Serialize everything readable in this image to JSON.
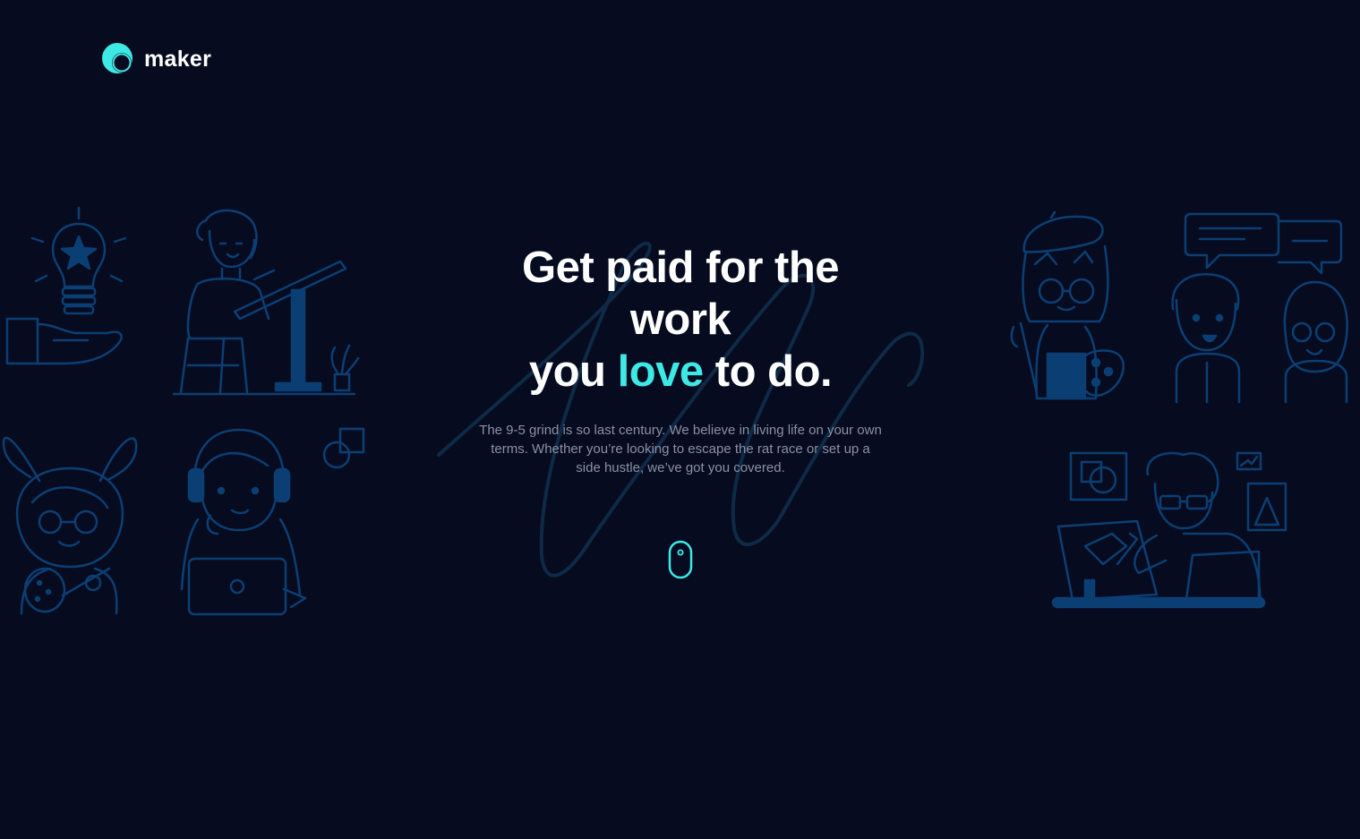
{
  "brand": {
    "name": "maker",
    "accent_color": "#3ee9e5",
    "background_color": "#060b1f"
  },
  "hero": {
    "title_line1": "Get paid for the",
    "title_line2": "work",
    "title_line3_pre": "you",
    "title_highlight": "love",
    "title_line3_post": "to do.",
    "description": "The 9-5 grind is so last century. We believe in living life on your own terms. Whether you’re looking to escape the rat race or set up a side hustle, we’ve got you covered."
  },
  "scroll_indicator": {
    "icon": "mouse-icon"
  },
  "illustrations": [
    "lightbulb-hand-icon",
    "drawing-table-person-icon",
    "bunny-ears-painter-icon",
    "headphones-laptop-person-icon",
    "shapes-icon",
    "beret-painter-icon",
    "chat-people-icon",
    "tablet-designer-icon"
  ]
}
